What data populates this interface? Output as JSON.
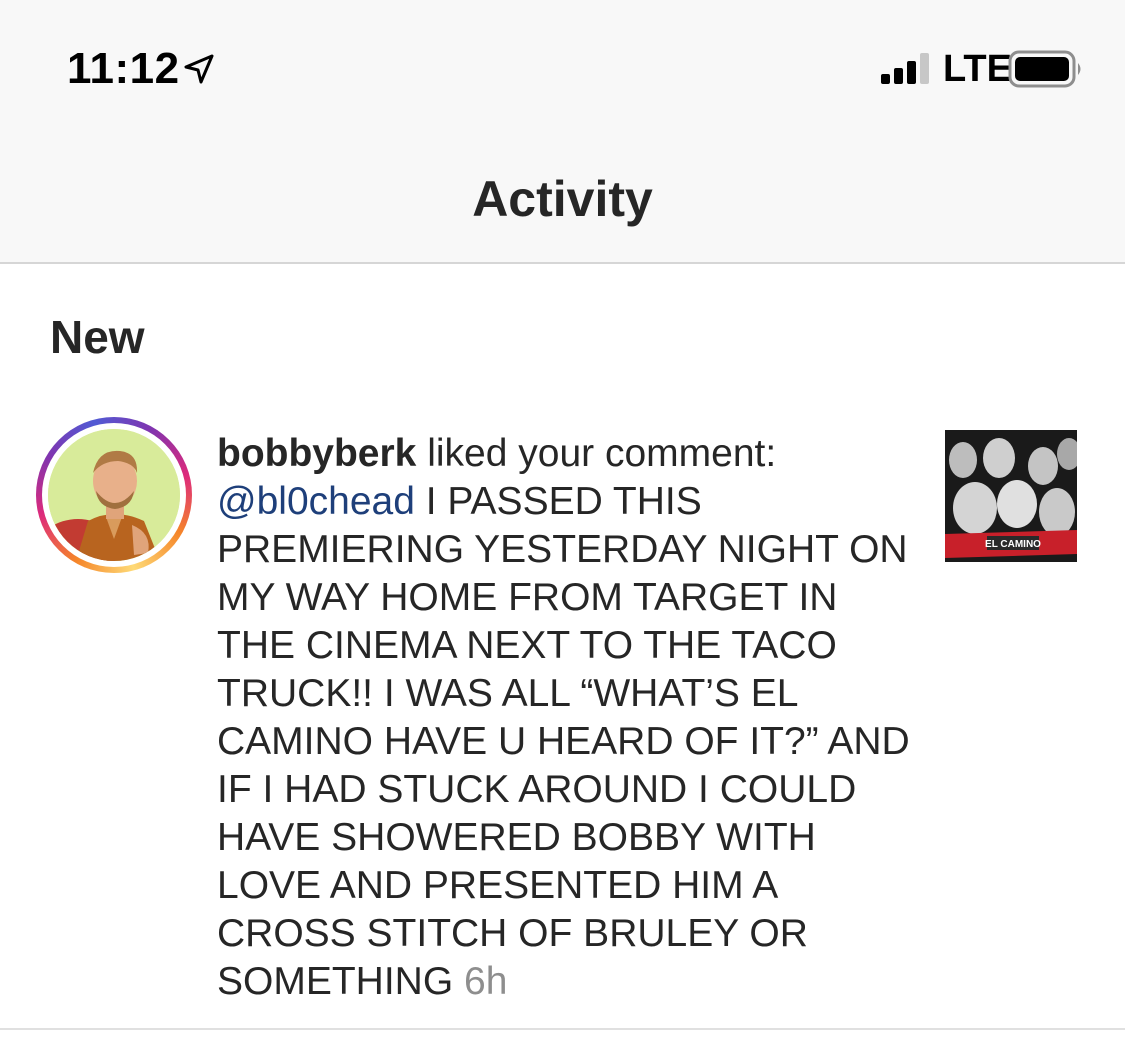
{
  "status_bar": {
    "time": "11:12",
    "network": "LTE"
  },
  "header": {
    "title": "Activity"
  },
  "section": {
    "title": "New"
  },
  "notification": {
    "username": "bobbyberk",
    "action": "liked your comment:",
    "mention": "@bl0chead",
    "comment": "I PASSED THIS PREMIERING YESTERDAY NIGHT ON MY WAY HOME FROM TARGET IN THE CINEMA NEXT TO THE TACO TRUCK!! I WAS ALL “WHAT’S EL CAMINO HAVE U HEARD OF IT?” AND IF I HAD STUCK AROUND I COULD HAVE SHOWERED BOBBY WITH LOVE AND PRESENTED HIM A CROSS STITCH OF BRULEY OR SOMETHING",
    "time": "6h",
    "thumbnail_label": "EL CAMINO"
  },
  "colors": {
    "mention": "#1e3f7a",
    "timestamp": "#8e8e8e",
    "header_bg": "#f8f8f8"
  }
}
